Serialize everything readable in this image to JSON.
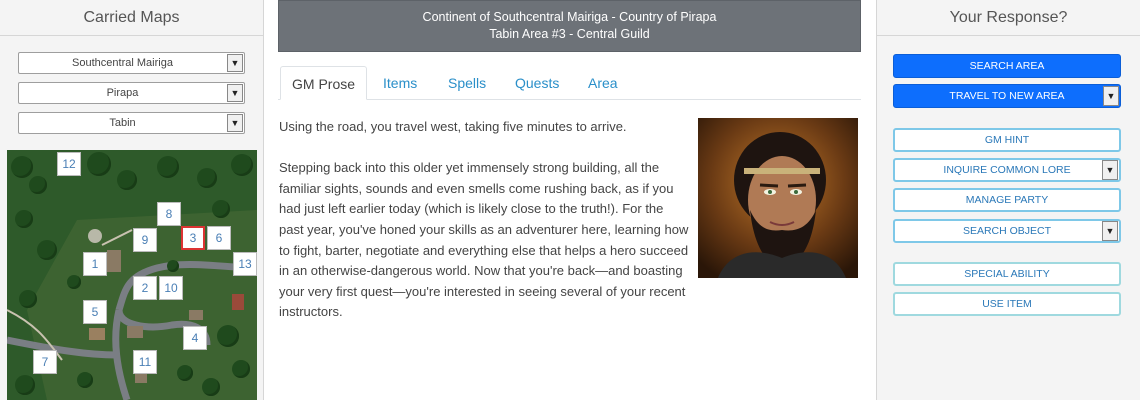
{
  "left": {
    "title": "Carried Maps",
    "selects": [
      {
        "value": "Southcentral Mairiga"
      },
      {
        "value": "Pirapa"
      },
      {
        "value": "Tabin"
      }
    ],
    "map_markers": [
      "12",
      "8",
      "9",
      "3",
      "6",
      "1",
      "13",
      "2",
      "10",
      "5",
      "4",
      "7",
      "11"
    ]
  },
  "header": {
    "line1": "Continent of Southcentral Mairiga - Country of Pirapa",
    "line2": "Tabin Area #3 - Central Guild"
  },
  "tabs": [
    "GM Prose",
    "Items",
    "Spells",
    "Quests",
    "Area"
  ],
  "prose": {
    "p1": "Using the road, you travel west, taking five minutes to arrive.",
    "p2": "Stepping back into this older yet immensely strong building, all the familiar sights, sounds and even smells come rushing back, as if you had just left earlier today (which is likely close to the truth!). For the past year, you've honed your skills as an adventurer here, learning how to fight, barter, negotiate and everything else that helps a hero succeed in an otherwise-dangerous world. Now that you're back—and boasting your very first quest—you're interested in seeing several of your recent instructors."
  },
  "right": {
    "title": "Your Response?",
    "buttons": {
      "search_area": "SEARCH AREA",
      "travel": "TRAVEL TO NEW AREA",
      "gm_hint": "GM HINT",
      "inquire": "INQUIRE COMMON LORE",
      "manage_party": "MANAGE PARTY",
      "search_object": "SEARCH OBJECT",
      "special_ability": "SPECIAL ABILITY",
      "use_item": "USE ITEM"
    }
  },
  "colors": {
    "header_bg": "#6d7278",
    "primary_button": "#0d6efd",
    "tab_link": "#2a8fc9",
    "map_forest": "#2e5a2a"
  },
  "icons": {
    "select_arrow": "chevron-down-icon"
  }
}
